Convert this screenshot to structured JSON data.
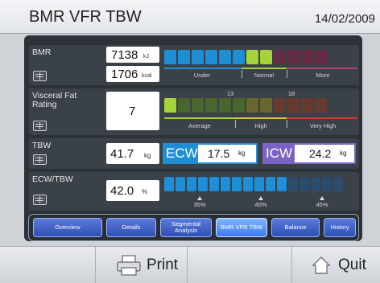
{
  "header": {
    "title": "BMR VFR TBW",
    "date": "14/02/2009"
  },
  "bmr": {
    "label": "BMR",
    "kj_value": "7138",
    "kj_unit": "kJ",
    "kcal_value": "1706",
    "kcal_unit": "kcal",
    "ranges": [
      "Under",
      "Normal",
      "More"
    ],
    "segments": [
      "#1e8fd6",
      "#1e8fd6",
      "#1e8fd6",
      "#1e8fd6",
      "#1e8fd6",
      "#1e8fd6",
      "#a6d33a",
      "#a6d33a",
      "#7a2a4a",
      "#7a2a4a",
      "#7a2a4a",
      "#7a2a4a"
    ],
    "filled": 8
  },
  "vfr": {
    "label": "Visceral Fat Rating",
    "value": "7",
    "ticks": [
      "13",
      "18"
    ],
    "ranges": [
      "Average",
      "High",
      "Very High"
    ],
    "segments": [
      "#a6d33a",
      "#4a6a2a",
      "#4a6a2a",
      "#4a6a2a",
      "#4a6a2a",
      "#4a6a2a",
      "#6b6a2a",
      "#6b6a2a",
      "#6b3a2a",
      "#6b3a2a",
      "#6b3a2a",
      "#6b3a2a"
    ],
    "filled": 1
  },
  "tbw": {
    "label": "TBW",
    "value": "41.7",
    "unit": "kg",
    "ecw_label": "ECW",
    "ecw_value": "17.5",
    "ecw_unit": "kg",
    "icw_label": "ICW",
    "icw_value": "24.2",
    "icw_unit": "kg"
  },
  "ratio": {
    "label": "ECW/TBW",
    "value": "42.0",
    "unit": "%",
    "ticks": [
      "35%",
      "40%",
      "45%"
    ],
    "segment_count": 16,
    "filled": 11
  },
  "tabs": [
    "Overview",
    "Details",
    "Segmental Analysis",
    "BMR VFR TBW",
    "Balance",
    "History"
  ],
  "active_tab": 3,
  "footer": {
    "print_label": "Print",
    "quit_label": "Quit"
  },
  "colors": {
    "accent_blue": "#1e8fd6",
    "accent_purple": "#7b63c6",
    "normal_green": "#a6d33a"
  }
}
